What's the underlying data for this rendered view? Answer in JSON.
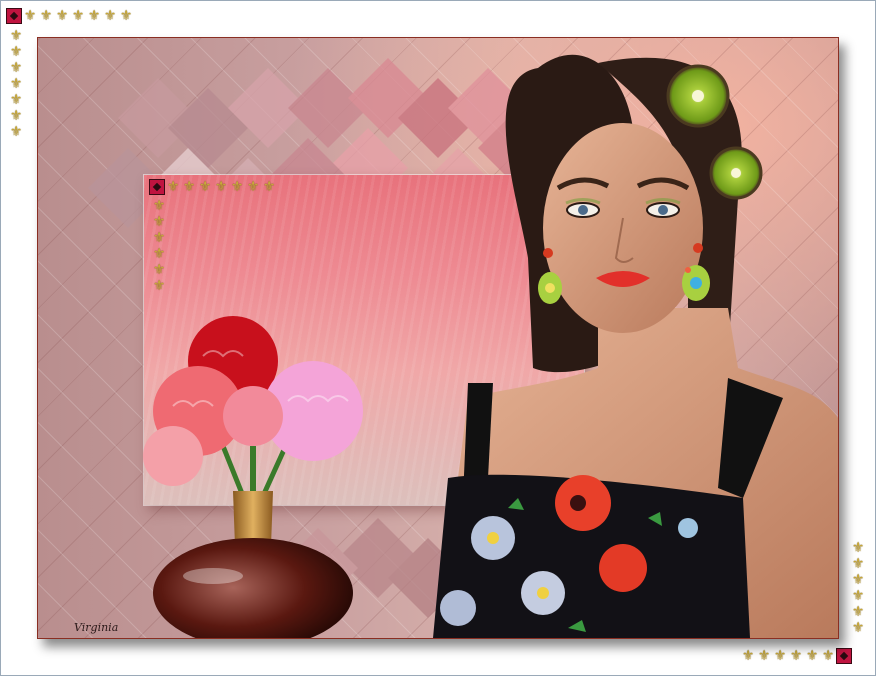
{
  "artwork": {
    "signature": "Virginia",
    "subject": "woman-with-kiwi-hair-ornaments-and-carnation-vase",
    "palette": {
      "background": "#c9a0a0",
      "panel": "#ee8a92",
      "frame": "#8a2e22",
      "deco_gold": "#c8a93a",
      "deco_red": "#c01440"
    }
  },
  "decorations": {
    "glyph": "⚜",
    "icon": "fleur-de-lis-icon"
  }
}
